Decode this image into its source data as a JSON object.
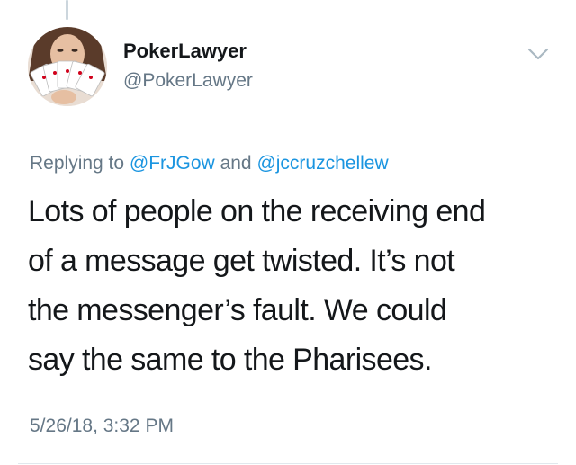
{
  "author": {
    "display_name": "PokerLawyer",
    "handle": "@PokerLawyer",
    "avatar_icon": "playing-cards-avatar"
  },
  "reply_context": {
    "prefix": "Replying to ",
    "mention_1": "@FrJGow",
    "conjunction": " and ",
    "mention_2": "@jccruzchellew"
  },
  "tweet": {
    "lines": [
      "Lots of people on the receiving end",
      "of a message get twisted. It’s not",
      "the messenger’s fault. We could",
      "say the same to the Pharisees."
    ],
    "timestamp": "5/26/18, 3:32 PM"
  },
  "menu": {
    "icon": "chevron-down-icon"
  },
  "colors": {
    "text": "#14171a",
    "secondary": "#657786",
    "link": "#1b95e0",
    "divider": "#e1e8ed"
  }
}
